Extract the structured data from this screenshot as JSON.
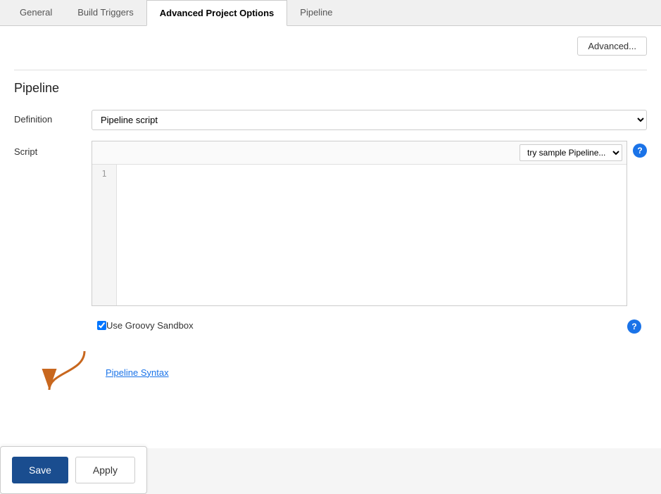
{
  "tabs": [
    {
      "id": "general",
      "label": "General",
      "active": false
    },
    {
      "id": "build-triggers",
      "label": "Build Triggers",
      "active": false
    },
    {
      "id": "advanced-project-options",
      "label": "Advanced Project Options",
      "active": true
    },
    {
      "id": "pipeline",
      "label": "Pipeline",
      "active": false
    }
  ],
  "advanced_button_label": "Advanced...",
  "pipeline_section_title": "Pipeline",
  "definition_label": "Definition",
  "definition_options": [
    "Pipeline script"
  ],
  "definition_selected": "Pipeline script",
  "script_label": "Script",
  "try_sample_options": [
    "try sample Pipeline..."
  ],
  "try_sample_selected": "try sample Pipeline...",
  "line_number": "1",
  "script_content": "",
  "groovy_sandbox_label": "Use Groovy Sandbox",
  "groovy_sandbox_checked": true,
  "pipeline_syntax_link": "Pipeline Syntax",
  "save_button_label": "Save",
  "apply_button_label": "Apply",
  "icons": {
    "help": "?",
    "checkbox_help": "?"
  }
}
